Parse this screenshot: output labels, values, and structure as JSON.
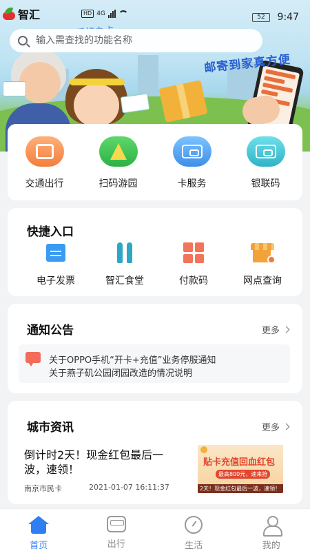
{
  "status_bar": {
    "time": "9:47",
    "battery": "52",
    "network": "4G"
  },
  "app": {
    "name": "智汇"
  },
  "search": {
    "placeholder": "输入需查找的功能名称"
  },
  "banner": {
    "slogan": "邮寄到家真方便",
    "top_text": "手机办卡"
  },
  "services": [
    {
      "label": "交通出行",
      "icon": "bus-card-icon",
      "color": "#f47e3c"
    },
    {
      "label": "扫码游园",
      "icon": "tree-icon",
      "color": "#2db144"
    },
    {
      "label": "卡服务",
      "icon": "card-icon",
      "color": "#3d8fe8"
    },
    {
      "label": "银联码",
      "icon": "unionpay-card-icon",
      "color": "#2fb4c7"
    }
  ],
  "quick_entry": {
    "title": "快捷入口",
    "items": [
      {
        "label": "电子发票",
        "icon": "invoice-icon"
      },
      {
        "label": "智汇食堂",
        "icon": "canteen-icon"
      },
      {
        "label": "付款码",
        "icon": "payment-code-icon"
      },
      {
        "label": "网点查询",
        "icon": "store-location-icon"
      }
    ]
  },
  "notice": {
    "title": "通知公告",
    "more": "更多",
    "items": [
      "关于OPPO手机“开卡+充值”业务停服通知",
      "关于燕子矶公园闭园改造的情况说明"
    ]
  },
  "news": {
    "title": "城市资讯",
    "more": "更多",
    "items": [
      {
        "headline": "倒计时2天！现金红包最后一波，速领！",
        "source": "南京市民卡",
        "date": "2021-01-07 16:11:37",
        "thumb_title": "贴卡充值回血红包",
        "thumb_badge": "最高800元，速来抢",
        "thumb_footer": "2天！现金红包最后一波，速领！"
      }
    ]
  },
  "tabbar": [
    {
      "label": "首页",
      "active": true
    },
    {
      "label": "出行",
      "active": false
    },
    {
      "label": "生活",
      "active": false
    },
    {
      "label": "我的",
      "active": false
    }
  ],
  "colors": {
    "accent": "#2f7ff2",
    "background": "#f2f3f5"
  }
}
